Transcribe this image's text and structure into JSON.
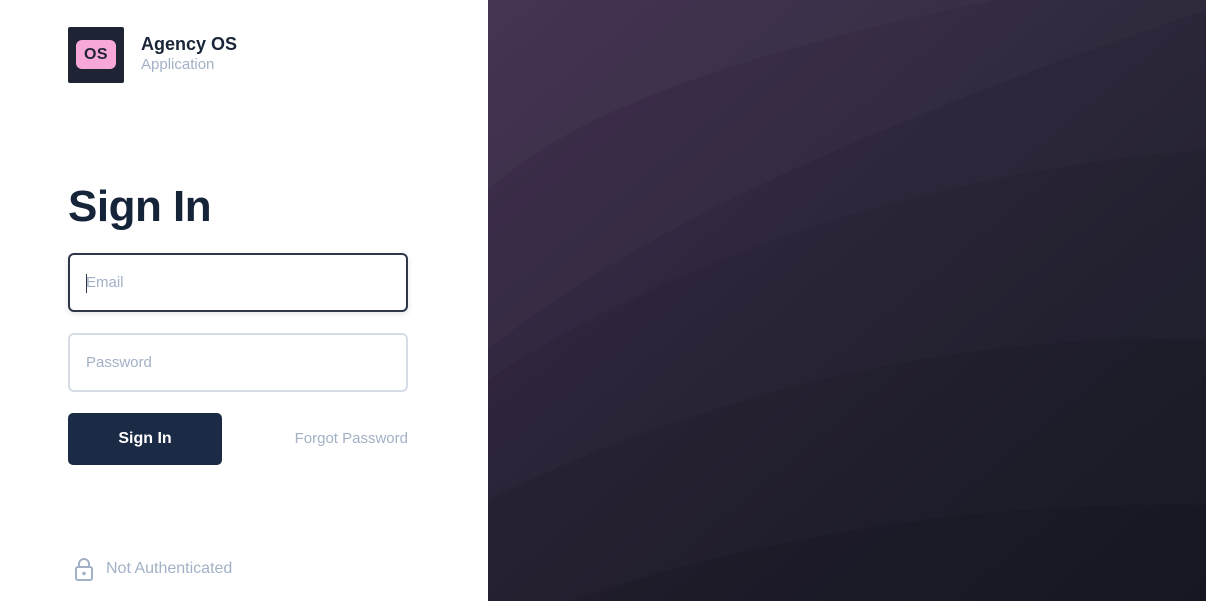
{
  "brand": {
    "logo_text": "OS",
    "name": "Agency OS",
    "subtitle": "Application"
  },
  "form": {
    "title": "Sign In",
    "email_placeholder": "Email",
    "password_placeholder": "Password",
    "submit_label": "Sign In",
    "forgot_label": "Forgot Password"
  },
  "status": {
    "icon": "lock-icon",
    "label": "Not Authenticated"
  },
  "colors": {
    "primary": "#1b2a45",
    "logo_accent": "#f7a8d8",
    "muted": "#a3b1c6",
    "panel_top": "#3e2a4c",
    "panel_bottom": "#1b1f2a"
  }
}
